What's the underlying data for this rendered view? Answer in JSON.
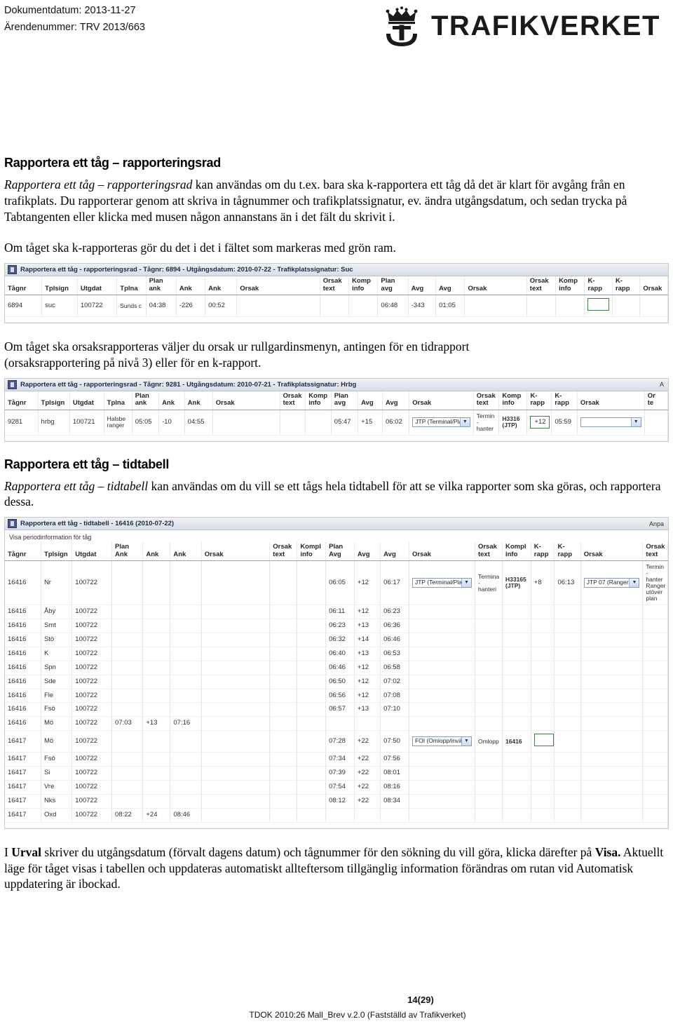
{
  "header": {
    "doc_date_label": "Dokumentdatum: 2013-11-27",
    "case_number_label": "Ärendenummer: TRV 2013/663",
    "logo_text": "TRAFIKVERKET",
    "logo_icon": "crown-anchor-icon"
  },
  "sections": [
    {
      "heading": "Rapportera ett tåg – rapporteringsrad",
      "intro_italic": "Rapportera ett tåg – rapporteringsrad",
      "intro_rest": " kan användas om du t.ex. bara ska k-rapportera ett tåg då det är klart för avgång från en trafikplats.  Du rapporterar genom att skriva in tågnummer och trafikplatssignatur, ev. ändra utgångsdatum, och sedan trycka på Tabtangenten eller klicka med musen någon annanstans än i det fält du skrivit i.",
      "note": "Om tåget ska k-rapporteras gör du det i det i fältet som markeras med grön ram."
    },
    {
      "note2_line1": "Om tåget ska orsaksrapporteras väljer du orsak ur rullgardinsmenyn, antingen för en tidrapport",
      "note2_line2": "(orsaksrapportering på nivå 3) eller för en k-rapport."
    },
    {
      "heading": "Rapportera ett tåg – tidtabell",
      "intro_italic": "Rapportera ett tåg – tidtabell",
      "intro_rest": " kan användas om du vill se ett tågs hela tidtabell för att se vilka rapporter som ska göras, och rapportera dessa."
    }
  ],
  "closing": {
    "line_lead": "I ",
    "line_bold1": "Urval",
    "line_mid1": " skriver du utgångsdatum (förvalt dagens datum) och tågnummer för den sökning du vill göra, klicka därefter på ",
    "line_bold2": "Visa.",
    "line_mid2": " Aktuellt läge för tåget visas i tabellen och uppdateras automatiskt allteftersom tillgänglig information förändras om rutan vid Automatisk uppdatering är ibockad."
  },
  "screenshot1": {
    "title": "Rapportera ett tåg - rapporteringsrad - Tågnr: 6894 - Utgångsdatum: 2010-07-22 - Trafikplatssignatur: Suc",
    "columns": [
      "Tågnr",
      "Tplsign",
      "Utgdat",
      "Tplna",
      "Plan\nank",
      "Ank",
      "Ank",
      "Orsak",
      "Orsak\ntext",
      "Komp\ninfo",
      "Plan\navg",
      "Avg",
      "Avg",
      "Orsak",
      "Orsak\ntext",
      "Komp\ninfo",
      "K-\nrapp",
      "K-\nrapp",
      "Orsak"
    ],
    "row": {
      "tagnr": "6894",
      "tplsign": "suc",
      "utgdat": "100722",
      "tplnamn": "Sunds c",
      "plan_ank": "04:38",
      "ank_diff": "-226",
      "ank": "00:52",
      "orsak_ank": "",
      "orsak_text_ank": "",
      "komp_info_ank": "",
      "plan_avg": "06:48",
      "avg_diff": "-343",
      "avg": "01:05",
      "orsak_avg": "",
      "orsak_text_avg": "",
      "komp_info_avg": "",
      "krapp_diff": "",
      "krapp_time": "",
      "orsak_krapp": ""
    },
    "highlight": "green-frame-on-krapp-field"
  },
  "screenshot2": {
    "title": "Rapportera ett tåg - rapporteringsrad - Tågnr: 9281 - Utgångsdatum: 2010-07-21 - Trafikplatssignatur: Hrbg",
    "title_right": "A",
    "columns": [
      "Tågnr",
      "Tplsign",
      "Utgdat",
      "Tplna",
      "Plan\nank",
      "Ank",
      "Ank",
      "Orsak",
      "Orsak\ntext",
      "Komp\ninfo",
      "Plan\navg",
      "Avg",
      "Avg",
      "Orsak",
      "Orsak\ntext",
      "Komp\ninfo",
      "K-\nrapp",
      "K-\nrapp",
      "Orsak",
      "Or\nte"
    ],
    "row": {
      "tagnr": "9281",
      "tplsign": "hrbg",
      "utgdat": "100721",
      "tplnamn": "Halsbe ranger",
      "plan_ank": "05:05",
      "ank_diff": "-10",
      "ank": "04:55",
      "orsak_ank": "",
      "orsak_text_ank": "",
      "komp_info_ank": "",
      "plan_avg": "05:47",
      "avg_diff": "+15",
      "avg": "06:02",
      "orsak_avg_select": "JTP (Terminal/Pla",
      "orsak_text_avg": "Termin - hanter",
      "komp_info_avg": "H3316 (JTP)",
      "krapp_diff": "+12",
      "krapp_time": "05:59",
      "orsak_krapp_select": ""
    },
    "highlight": "green-frame-on-krapp-diff-field"
  },
  "screenshot3": {
    "title": "Rapportera ett tåg - tidtabell - 16416 (2010-07-22)",
    "title_right": "Anpa",
    "subbar": "Visa periodinformation för tåg",
    "columns": [
      "Tågnr",
      "Tplsign",
      "Utgdat",
      "Plan\nAnk",
      "Ank",
      "Ank",
      "Orsak",
      "Orsak\ntext",
      "Kompl\ninfo",
      "Plan\nAvg",
      "Avg",
      "Avg",
      "Orsak",
      "Orsak\ntext",
      "Kompl\ninfo",
      "K-\nrapp",
      "K-\nrapp",
      "Orsak",
      "Orsak\ntext"
    ],
    "rows": [
      {
        "tagnr": "16416",
        "tplsign": "Nr",
        "utgdat": "100722",
        "plan_ank": "",
        "ank_diff": "",
        "ank": "",
        "orsak_ank": "",
        "orsak_text_ank": "",
        "kompl_info_ank": "",
        "plan_avg": "06:05",
        "avg_diff": "+12",
        "avg": "06:17",
        "orsak_avg_select": "JTP (Terminal/Pla",
        "orsak_text_avg": "Termina - hanteri",
        "kompl_info_avg": "H33165 (JTP)",
        "krapp_diff": "+8",
        "krapp_time": "06:13",
        "orsak_krapp_select": "JTP 07 (Ranger/v",
        "orsak_text_krapp": "Termin - hanter Ranger utöver plan",
        "tall": true
      },
      {
        "tagnr": "16416",
        "tplsign": "Åby",
        "utgdat": "100722",
        "plan_avg": "06:11",
        "avg_diff": "+12",
        "avg": "06:23"
      },
      {
        "tagnr": "16416",
        "tplsign": "Smt",
        "utgdat": "100722",
        "plan_avg": "06:23",
        "avg_diff": "+13",
        "avg": "06:36"
      },
      {
        "tagnr": "16416",
        "tplsign": "Stö",
        "utgdat": "100722",
        "plan_avg": "06:32",
        "avg_diff": "+14",
        "avg": "06:46"
      },
      {
        "tagnr": "16416",
        "tplsign": "K",
        "utgdat": "100722",
        "plan_avg": "06:40",
        "avg_diff": "+13",
        "avg": "06:53"
      },
      {
        "tagnr": "16416",
        "tplsign": "Spn",
        "utgdat": "100722",
        "plan_avg": "06:46",
        "avg_diff": "+12",
        "avg": "06:58"
      },
      {
        "tagnr": "16416",
        "tplsign": "Sde",
        "utgdat": "100722",
        "plan_avg": "06:50",
        "avg_diff": "+12",
        "avg": "07:02"
      },
      {
        "tagnr": "16416",
        "tplsign": "Fle",
        "utgdat": "100722",
        "plan_avg": "06:56",
        "avg_diff": "+12",
        "avg": "07:08"
      },
      {
        "tagnr": "16416",
        "tplsign": "Fsö",
        "utgdat": "100722",
        "plan_avg": "06:57",
        "avg_diff": "+13",
        "avg": "07:10"
      },
      {
        "tagnr": "16416",
        "tplsign": "Mö",
        "utgdat": "100722",
        "plan_ank": "07:03",
        "ank_diff": "+13",
        "ank": "07:16"
      },
      {
        "tagnr": "16417",
        "tplsign": "Mö",
        "utgdat": "100722",
        "plan_avg": "07:28",
        "avg_diff": "+22",
        "avg": "07:50",
        "orsak_avg_select": "FOI (Omlopp/invä",
        "orsak_text_avg": "Omlopp",
        "kompl_info_avg": "16416",
        "krapp_green_empty": true
      },
      {
        "tagnr": "16417",
        "tplsign": "Fsö",
        "utgdat": "100722",
        "plan_avg": "07:34",
        "avg_diff": "+22",
        "avg": "07:56"
      },
      {
        "tagnr": "16417",
        "tplsign": "Si",
        "utgdat": "100722",
        "plan_avg": "07:39",
        "avg_diff": "+22",
        "avg": "08:01"
      },
      {
        "tagnr": "16417",
        "tplsign": "Vre",
        "utgdat": "100722",
        "plan_avg": "07:54",
        "avg_diff": "+22",
        "avg": "08:16"
      },
      {
        "tagnr": "16417",
        "tplsign": "Nks",
        "utgdat": "100722",
        "plan_avg": "08:12",
        "avg_diff": "+22",
        "avg": "08:34"
      },
      {
        "tagnr": "16417",
        "tplsign": "Oxd",
        "utgdat": "100722",
        "plan_ank": "08:22",
        "ank_diff": "+24",
        "ank": "08:46"
      }
    ]
  },
  "footer": {
    "page_number": "14(29)",
    "template_line": "TDOK 2010:26 Mall_Brev v.2.0 (Fastställd av Trafikverket)"
  },
  "colors": {
    "green_frame": "#3f7d4a",
    "title_bar": "#e2e7ee",
    "text": "#000000"
  }
}
